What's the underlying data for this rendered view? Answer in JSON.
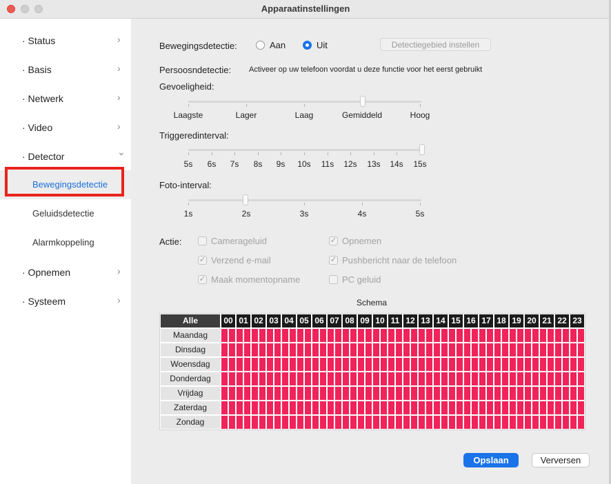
{
  "window": {
    "title": "Apparaatinstellingen"
  },
  "sidebar": {
    "items": [
      {
        "label": "· Status",
        "chevron": "›"
      },
      {
        "label": "· Basis",
        "chevron": "›"
      },
      {
        "label": "· Netwerk",
        "chevron": "›"
      },
      {
        "label": "· Video",
        "chevron": "›"
      },
      {
        "label": "· Detector",
        "chevron": "⌄"
      },
      {
        "label": "· Opnemen",
        "chevron": "›"
      },
      {
        "label": "· Systeem",
        "chevron": "›"
      }
    ],
    "subitems": [
      {
        "label": "Bewegingsdetectie",
        "active": true
      },
      {
        "label": "Geluidsdetectie",
        "active": false
      },
      {
        "label": "Alarmkoppeling",
        "active": false
      }
    ]
  },
  "motion": {
    "label": "Bewegingsdetectie:",
    "option_on": "Aan",
    "option_off": "Uit",
    "selected": "Uit",
    "area_button": "Detectiegebied instellen"
  },
  "person": {
    "label": "Persoosndetectie:",
    "note": "Activeer op uw telefoon voordat u deze functie voor het eerst gebruikt"
  },
  "sensitivity": {
    "label": "Gevoeligheid:",
    "ticks": [
      "Laagste",
      "Lager",
      "Laag",
      "Gemiddeld",
      "Hoog"
    ],
    "value": "Gemiddeld"
  },
  "trigger": {
    "label": "Triggeredinterval:",
    "ticks": [
      "5s",
      "6s",
      "7s",
      "8s",
      "9s",
      "10s",
      "11s",
      "12s",
      "13s",
      "14s",
      "15s"
    ],
    "value": "15s"
  },
  "photo": {
    "label": "Foto-interval:",
    "ticks": [
      "1s",
      "2s",
      "3s",
      "4s",
      "5s"
    ],
    "value": "2s"
  },
  "action": {
    "label": "Actie:",
    "checks": [
      {
        "label": "Camerageluid",
        "checked": false
      },
      {
        "label": "Opnemen",
        "checked": true
      },
      {
        "label": "Verzend e-mail",
        "checked": true
      },
      {
        "label": "Pushbericht naar de telefoon",
        "checked": true
      },
      {
        "label": "Maak momentopname",
        "checked": true
      },
      {
        "label": "PC geluid",
        "checked": false
      }
    ]
  },
  "schedule": {
    "title": "Schema",
    "all_label": "Alle",
    "hours": [
      "00",
      "01",
      "02",
      "03",
      "04",
      "05",
      "06",
      "07",
      "08",
      "09",
      "10",
      "11",
      "12",
      "13",
      "14",
      "15",
      "16",
      "17",
      "18",
      "19",
      "20",
      "21",
      "22",
      "23"
    ],
    "days": [
      "Maandag",
      "Dinsdag",
      "Woensdag",
      "Donderdag",
      "Vrijdag",
      "Zaterdag",
      "Zondag"
    ],
    "active_color": "#f0245a",
    "all_selected": true
  },
  "buttons": {
    "save": "Opslaan",
    "refresh": "Verversen"
  },
  "colors": {
    "accent": "#1a73e8",
    "highlight": "#e8231b"
  }
}
